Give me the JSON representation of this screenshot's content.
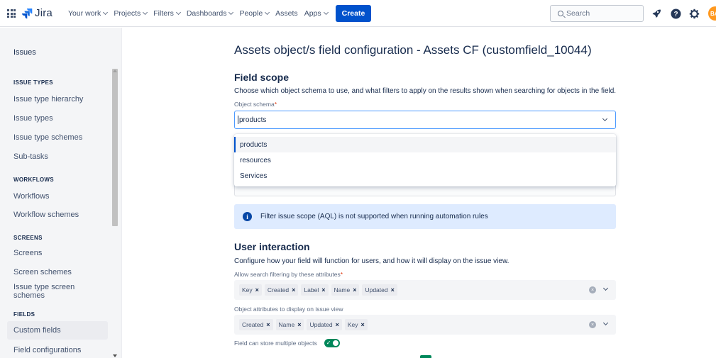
{
  "topbar": {
    "logo_text": "Jira",
    "nav": [
      {
        "label": "Your work",
        "dropdown": true
      },
      {
        "label": "Projects",
        "dropdown": true
      },
      {
        "label": "Filters",
        "dropdown": true
      },
      {
        "label": "Dashboards",
        "dropdown": true
      },
      {
        "label": "People",
        "dropdown": true
      },
      {
        "label": "Assets",
        "dropdown": false
      },
      {
        "label": "Apps",
        "dropdown": true
      }
    ],
    "create_label": "Create",
    "search_placeholder": "Search",
    "avatar_initials": "BA",
    "icons": [
      "rocket-icon",
      "help-icon",
      "gear-icon"
    ]
  },
  "sidebar": {
    "title": "Issues",
    "sections": [
      {
        "heading": "ISSUE TYPES",
        "items": [
          "Issue type hierarchy",
          "Issue types",
          "Issue type schemes",
          "Sub-tasks"
        ]
      },
      {
        "heading": "WORKFLOWS",
        "items": [
          "Workflows",
          "Workflow schemes"
        ]
      },
      {
        "heading": "SCREENS",
        "items": [
          "Screens",
          "Screen schemes",
          "Issue type screen schemes"
        ]
      },
      {
        "heading": "FIELDS",
        "items": [
          "Custom fields",
          "Field configurations"
        ]
      }
    ],
    "active_item": "Custom fields"
  },
  "main": {
    "title": "Assets object/s field configuration - Assets CF (customfield_10044)",
    "field_scope": {
      "heading": "Field scope",
      "description": "Choose which object schema to use, and what filters to apply on the results shown when searching for objects in the field.",
      "schema_label": "Object schema",
      "schema_value": "products",
      "options": [
        "products",
        "resources",
        "Services"
      ],
      "selected_option": "products"
    },
    "info_message": "Filter issue scope (AQL) is not supported when running automation rules",
    "user_interaction": {
      "heading": "User interaction",
      "description": "Configure how your field will function for users, and how it will display on the issue view.",
      "search_attr_label": "Allow search filtering by these attributes",
      "search_attrs": [
        "Key",
        "Created",
        "Label",
        "Name",
        "Updated"
      ],
      "display_attr_label": "Object attributes to display on issue view",
      "display_attrs": [
        "Created",
        "Name",
        "Updated",
        "Key"
      ],
      "multiple_label": "Field can store multiple objects",
      "multiple_enabled": true
    }
  },
  "colors": {
    "brand_blue": "#0052cc",
    "info_bg": "#deebff",
    "toggle_on": "#00875a",
    "required": "#de350b"
  }
}
